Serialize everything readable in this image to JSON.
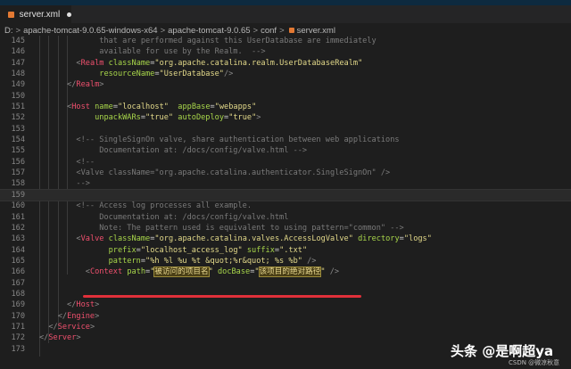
{
  "tab": {
    "title": "server.xml",
    "icon": "rss-icon"
  },
  "breadcrumb": [
    "D:",
    "apache-tomcat-9.0.65-windows-x64",
    "apache-tomcat-9.0.65",
    "conf",
    "server.xml"
  ],
  "current_line": 159,
  "lines": [
    {
      "n": 145,
      "tokens": [
        [
          "c",
          "             that are performed against this UserDatabase are immediately"
        ]
      ]
    },
    {
      "n": 146,
      "tokens": [
        [
          "c",
          "             available for use by the Realm.  -->"
        ]
      ]
    },
    {
      "n": 147,
      "tokens": [
        [
          "e",
          "        "
        ],
        [
          "p",
          "<"
        ],
        [
          "t",
          "Realm"
        ],
        [
          "e",
          " "
        ],
        [
          "a",
          "className"
        ],
        [
          "e",
          "="
        ],
        [
          "s",
          "\"org.apache.catalina.realm.UserDatabaseRealm\""
        ]
      ]
    },
    {
      "n": 148,
      "tokens": [
        [
          "e",
          "             "
        ],
        [
          "a",
          "resourceName"
        ],
        [
          "e",
          "="
        ],
        [
          "s",
          "\"UserDatabase\""
        ],
        [
          "p",
          "/>"
        ]
      ]
    },
    {
      "n": 149,
      "tokens": [
        [
          "e",
          "      "
        ],
        [
          "p",
          "</"
        ],
        [
          "t",
          "Realm"
        ],
        [
          "p",
          ">"
        ]
      ]
    },
    {
      "n": 150,
      "tokens": []
    },
    {
      "n": 151,
      "tokens": [
        [
          "e",
          "      "
        ],
        [
          "p",
          "<"
        ],
        [
          "t",
          "Host"
        ],
        [
          "e",
          " "
        ],
        [
          "a",
          "name"
        ],
        [
          "e",
          "="
        ],
        [
          "s",
          "\"localhost\""
        ],
        [
          "e",
          "  "
        ],
        [
          "a",
          "appBase"
        ],
        [
          "e",
          "="
        ],
        [
          "s",
          "\"webapps\""
        ]
      ]
    },
    {
      "n": 152,
      "tokens": [
        [
          "e",
          "            "
        ],
        [
          "a",
          "unpackWARs"
        ],
        [
          "e",
          "="
        ],
        [
          "s",
          "\"true\""
        ],
        [
          "e",
          " "
        ],
        [
          "a",
          "autoDeploy"
        ],
        [
          "e",
          "="
        ],
        [
          "s",
          "\"true\""
        ],
        [
          "p",
          ">"
        ]
      ]
    },
    {
      "n": 153,
      "tokens": []
    },
    {
      "n": 154,
      "tokens": [
        [
          "c",
          "        <!-- SingleSignOn valve, share authentication between web applications"
        ]
      ]
    },
    {
      "n": 155,
      "tokens": [
        [
          "c",
          "             Documentation at: /docs/config/valve.html -->"
        ]
      ]
    },
    {
      "n": 156,
      "tokens": [
        [
          "c",
          "        <!--"
        ]
      ]
    },
    {
      "n": 157,
      "tokens": [
        [
          "c",
          "        <Valve className=\"org.apache.catalina.authenticator.SingleSignOn\" />"
        ]
      ]
    },
    {
      "n": 158,
      "tokens": [
        [
          "c",
          "        -->"
        ]
      ]
    },
    {
      "n": 159,
      "tokens": []
    },
    {
      "n": 160,
      "tokens": [
        [
          "c",
          "        <!-- Access log processes all example."
        ]
      ]
    },
    {
      "n": 161,
      "tokens": [
        [
          "c",
          "             Documentation at: /docs/config/valve.html"
        ]
      ]
    },
    {
      "n": 162,
      "tokens": [
        [
          "c",
          "             Note: The pattern used is equivalent to using pattern=\"common\" -->"
        ]
      ]
    },
    {
      "n": 163,
      "tokens": [
        [
          "e",
          "        "
        ],
        [
          "p",
          "<"
        ],
        [
          "t",
          "Valve"
        ],
        [
          "e",
          " "
        ],
        [
          "a",
          "className"
        ],
        [
          "e",
          "="
        ],
        [
          "s",
          "\"org.apache.catalina.valves.AccessLogValve\""
        ],
        [
          "e",
          " "
        ],
        [
          "a",
          "directory"
        ],
        [
          "e",
          "="
        ],
        [
          "s",
          "\"logs\""
        ]
      ]
    },
    {
      "n": 164,
      "tokens": [
        [
          "e",
          "               "
        ],
        [
          "a",
          "prefix"
        ],
        [
          "e",
          "="
        ],
        [
          "s",
          "\"localhost_access_log\""
        ],
        [
          "e",
          " "
        ],
        [
          "a",
          "suffix"
        ],
        [
          "e",
          "="
        ],
        [
          "s",
          "\".txt\""
        ]
      ]
    },
    {
      "n": 165,
      "tokens": [
        [
          "e",
          "               "
        ],
        [
          "a",
          "pattern"
        ],
        [
          "e",
          "="
        ],
        [
          "s",
          "\"%h %l %u %t &quot;%r&quot; %s %b\""
        ],
        [
          "e",
          " "
        ],
        [
          "p",
          "/>"
        ]
      ]
    },
    {
      "n": 166,
      "tokens": [
        [
          "e",
          "          "
        ],
        [
          "p",
          "<"
        ],
        [
          "t",
          "Context"
        ],
        [
          "e",
          " "
        ],
        [
          "a",
          "path"
        ],
        [
          "e",
          "="
        ],
        [
          "s",
          "\""
        ],
        [
          "hl",
          "被访问的项目名"
        ],
        [
          "s",
          "\""
        ],
        [
          "e",
          " "
        ],
        [
          "a",
          "docBase"
        ],
        [
          "e",
          "="
        ],
        [
          "s",
          "\""
        ],
        [
          "hl",
          "该项目的绝对路径"
        ],
        [
          "s",
          "\""
        ],
        [
          "e",
          " "
        ],
        [
          "p",
          "/>"
        ]
      ]
    },
    {
      "n": 167,
      "tokens": []
    },
    {
      "n": 168,
      "tokens": []
    },
    {
      "n": 169,
      "tokens": [
        [
          "e",
          "      "
        ],
        [
          "p",
          "</"
        ],
        [
          "t",
          "Host"
        ],
        [
          "p",
          ">"
        ]
      ]
    },
    {
      "n": 170,
      "tokens": [
        [
          "e",
          "    "
        ],
        [
          "p",
          "</"
        ],
        [
          "t",
          "Engine"
        ],
        [
          "p",
          ">"
        ]
      ]
    },
    {
      "n": 171,
      "tokens": [
        [
          "e",
          "  "
        ],
        [
          "p",
          "</"
        ],
        [
          "t",
          "Service"
        ],
        [
          "p",
          ">"
        ]
      ]
    },
    {
      "n": 172,
      "tokens": [
        [
          "p",
          "</"
        ],
        [
          "t",
          "Server"
        ],
        [
          "p",
          ">"
        ]
      ]
    },
    {
      "n": 173,
      "tokens": []
    }
  ],
  "watermark": {
    "main": "头条 @是啊超ya",
    "sub": "CSDN @微凉秋意"
  }
}
